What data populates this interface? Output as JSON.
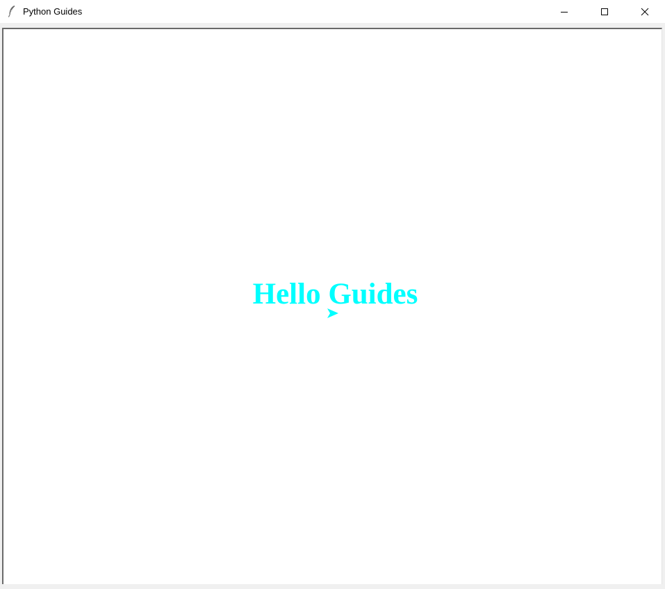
{
  "window": {
    "title": "Python Guides",
    "app_icon": "feather-icon",
    "controls": {
      "minimize_icon": "minimize-icon",
      "maximize_icon": "maximize-icon",
      "close_icon": "close-icon"
    }
  },
  "canvas": {
    "background": "#ffffff",
    "text": "Hello Guides",
    "text_color": "#00ffff",
    "arrow_icon": "arrow-right-icon"
  }
}
